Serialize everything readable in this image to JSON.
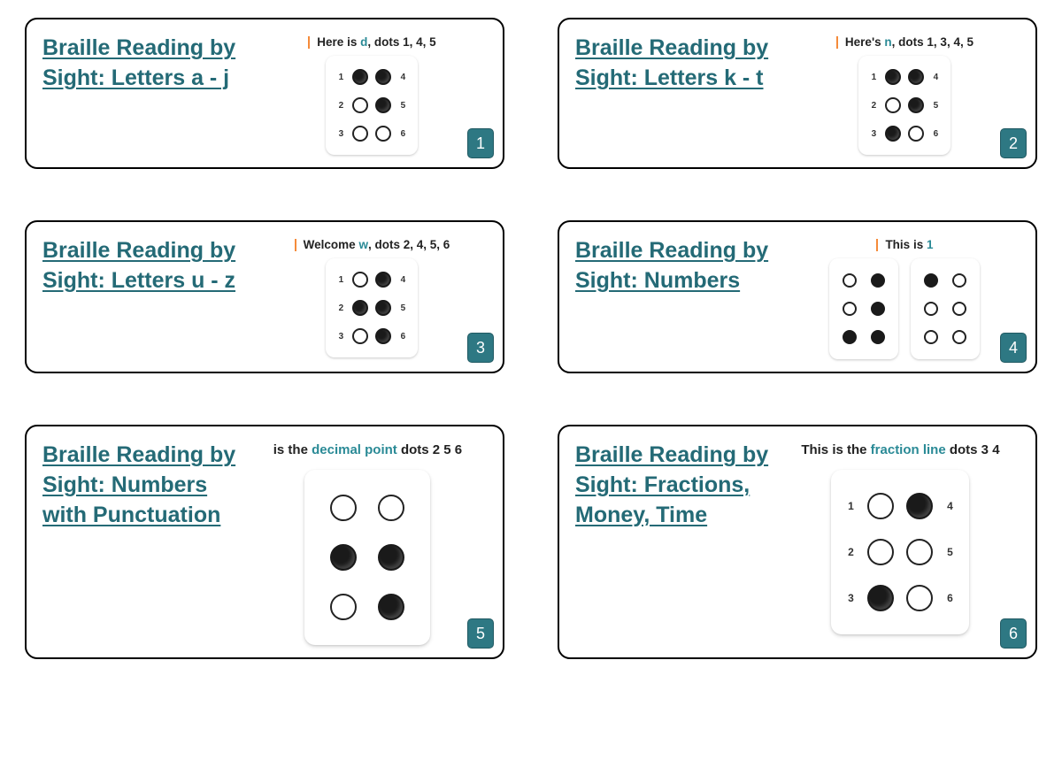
{
  "cards": [
    {
      "title": "Braille Reading by Sight: Letters a - j",
      "badge": "1",
      "caption": {
        "prefix": "Here is ",
        "hl": "d",
        "suffix": ", dots 1, 4, 5"
      },
      "captionStyle": "bar",
      "cell": {
        "type": "labeled",
        "dots": [
          1,
          4,
          5
        ]
      }
    },
    {
      "title": "Braille Reading by Sight: Letters k - t",
      "badge": "2",
      "caption": {
        "prefix": "Here's ",
        "hl": "n",
        "suffix": ", dots 1, 3, 4, 5"
      },
      "captionStyle": "bar",
      "cell": {
        "type": "labeled",
        "dots": [
          1,
          3,
          4,
          5
        ]
      }
    },
    {
      "title": "Braille Reading by Sight: Letters u - z",
      "badge": "3",
      "caption": {
        "prefix": "Welcome ",
        "hl": "w",
        "suffix": ", dots 2, 4, 5, 6"
      },
      "captionStyle": "bar",
      "cell": {
        "type": "labeled",
        "dots": [
          2,
          4,
          5,
          6
        ]
      }
    },
    {
      "title": "Braille Reading by Sight: Numbers",
      "badge": "4",
      "caption": {
        "prefix": "This is ",
        "hl": "1",
        "suffix": ""
      },
      "captionStyle": "bar",
      "cell": {
        "type": "twin",
        "left": [
          3,
          4,
          5,
          6
        ],
        "right": [
          1
        ]
      }
    },
    {
      "title": "Braille Reading by Sight: Numbers with Punctuation",
      "badge": "5",
      "caption": {
        "prefix": "is the ",
        "hl": "decimal point",
        "suffix": " dots 2 5 6"
      },
      "captionStyle": "large",
      "cell": {
        "type": "nolab",
        "dots": [
          2,
          5,
          6
        ]
      }
    },
    {
      "title": "Braille Reading by Sight: Fractions, Money, Time",
      "badge": "6",
      "caption": {
        "prefix": "This is the ",
        "hl": "fraction line",
        "suffix": " dots 3 4"
      },
      "captionStyle": "large",
      "cell": {
        "type": "labeled-lg",
        "dots": [
          3,
          4
        ]
      }
    }
  ]
}
